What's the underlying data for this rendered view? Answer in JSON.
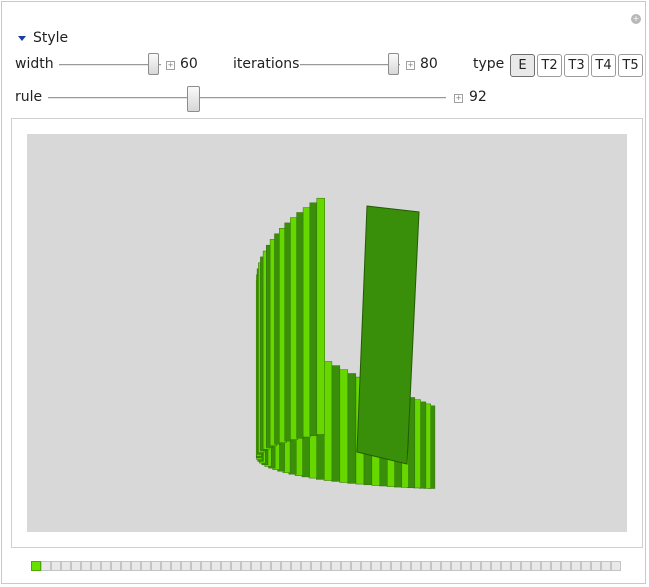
{
  "section_title": "Style",
  "controls": {
    "width": {
      "label": "width",
      "value": "60"
    },
    "iterations": {
      "label": "iterations",
      "value": "80"
    },
    "rule": {
      "label": "rule",
      "value": "92"
    },
    "type": {
      "label": "type",
      "options": [
        "E",
        "T2",
        "T3",
        "T4",
        "T5"
      ],
      "selected": "E"
    }
  },
  "progress": {
    "cells": 59,
    "filled": 1
  },
  "colors": {
    "bright_green": "#66d800",
    "dark_green": "#3a8f0a",
    "background": "#d8d8d8"
  }
}
